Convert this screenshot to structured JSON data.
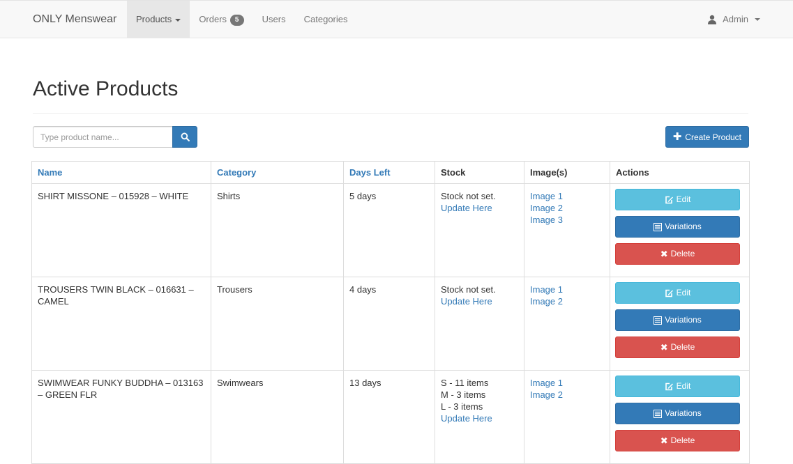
{
  "navbar": {
    "brand": "ONLY Menswear",
    "items": [
      {
        "label": "Products",
        "active": true,
        "dropdown": true
      },
      {
        "label": "Orders",
        "badge": "5"
      },
      {
        "label": "Users"
      },
      {
        "label": "Categories"
      }
    ],
    "user": {
      "label": "Admin",
      "icon": "user-icon"
    }
  },
  "page": {
    "title": "Active Products",
    "search": {
      "placeholder": "Type product name...",
      "icon": "search-icon"
    },
    "create_label": "Create Product"
  },
  "table": {
    "headers": [
      "Name",
      "Category",
      "Days Left",
      "Stock",
      "Image(s)",
      "Actions"
    ],
    "rows": [
      {
        "name": "SHIRT MISSONE – 015928 – WHITE",
        "category": "Shirts",
        "days_left": "5 days",
        "stock": [
          "Stock not set."
        ],
        "update_link": "Update Here",
        "images": [
          "Image 1",
          "Image 2",
          "Image 3"
        ]
      },
      {
        "name": "TROUSERS TWIN BLACK – 016631 – CAMEL",
        "category": "Trousers",
        "days_left": "4 days",
        "stock": [
          "Stock not set."
        ],
        "update_link": "Update Here",
        "images": [
          "Image 1",
          "Image 2"
        ]
      },
      {
        "name": "SWIMWEAR FUNKY BUDDHA – 013163 – GREEN FLR",
        "category": "Swimwears",
        "days_left": "13 days",
        "stock": [
          "S - 11 items",
          "M - 3 items",
          "L - 3 items"
        ],
        "update_link": "Update Here",
        "images": [
          "Image 1",
          "Image 2"
        ]
      }
    ],
    "actions": {
      "edit": "Edit",
      "variations": "Variations",
      "delete": "Delete"
    }
  },
  "colors": {
    "primary": "#337ab7",
    "info": "#5bc0de",
    "danger": "#d9534f",
    "navbar_bg": "#f8f8f8"
  }
}
